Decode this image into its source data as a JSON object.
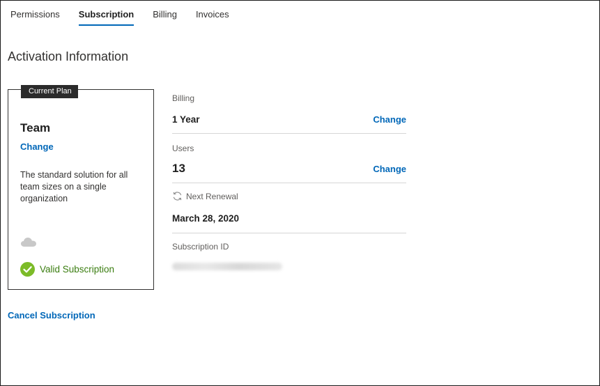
{
  "tabs": [
    {
      "label": "Permissions",
      "active": false
    },
    {
      "label": "Subscription",
      "active": true
    },
    {
      "label": "Billing",
      "active": false
    },
    {
      "label": "Invoices",
      "active": false
    }
  ],
  "section_title": "Activation Information",
  "plan": {
    "badge": "Current Plan",
    "name": "Team",
    "change_label": "Change",
    "description": "The standard solution for all team sizes on a single organization",
    "status": "Valid Subscription",
    "status_color": "#3a7d10",
    "status_icon": "check-circle-icon",
    "storage_icon": "cloud-icon"
  },
  "details": {
    "billing": {
      "label": "Billing",
      "value": "1 Year",
      "change_label": "Change"
    },
    "users": {
      "label": "Users",
      "value": "13",
      "change_label": "Change"
    },
    "renewal": {
      "label": "Next Renewal",
      "value": "March 28, 2020",
      "icon": "refresh-icon"
    },
    "subscription_id": {
      "label": "Subscription ID"
    }
  },
  "cancel_label": "Cancel Subscription",
  "colors": {
    "accent": "#0067b8",
    "success": "#7cbb28"
  }
}
